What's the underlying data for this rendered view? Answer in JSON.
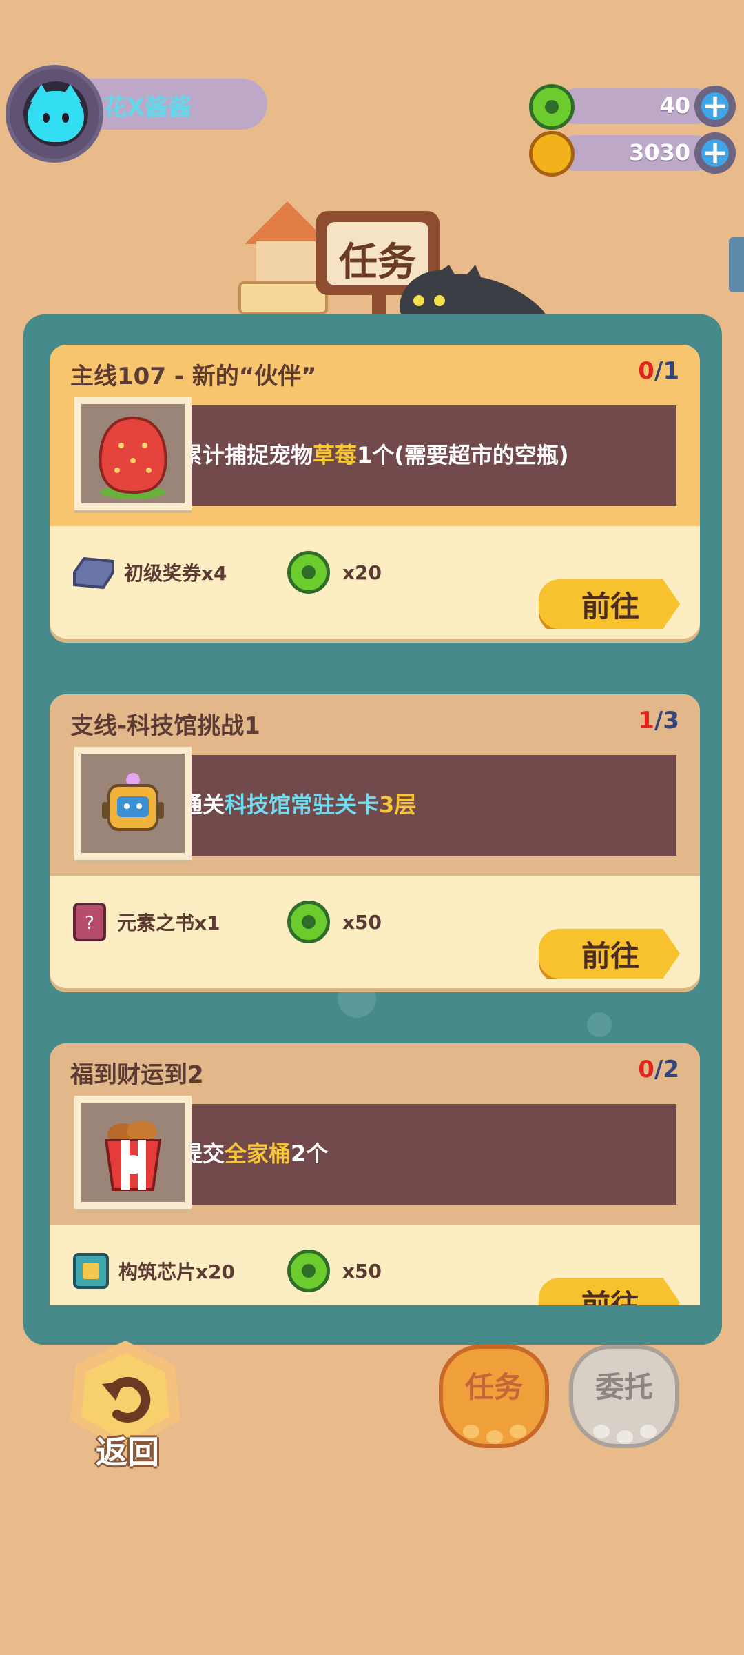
{
  "player": {
    "name": "花X酱酱"
  },
  "currencies": {
    "gems": {
      "value": "40",
      "icon": "green-donut-icon"
    },
    "coins": {
      "value": "3030",
      "icon": "gold-coin-icon"
    }
  },
  "header": {
    "title": "任务"
  },
  "tasks": [
    {
      "title": "主线107 - 新的“伙伴”",
      "progress_done": "0",
      "progress_sep": "/",
      "progress_total": "1",
      "desc_parts": [
        "累计捕捉宠物",
        "草莓",
        "1个(需要超市的空瓶)"
      ],
      "rewards": [
        {
          "label": "初级奖券x4",
          "icon": "ticket-icon"
        },
        {
          "label": "x20",
          "icon": "green-donut-icon"
        }
      ],
      "button": "前往",
      "thumb_icon": "strawberry-icon"
    },
    {
      "title": "支线-科技馆挑战1",
      "progress_done": "1",
      "progress_sep": "/",
      "progress_total": "3",
      "desc_parts": [
        "通关",
        "科技馆常驻关卡",
        "3层"
      ],
      "rewards": [
        {
          "label": "元素之书x1",
          "icon": "element-book-icon"
        },
        {
          "label": "x50",
          "icon": "green-donut-icon"
        }
      ],
      "button": "前往",
      "thumb_icon": "robot-icon"
    },
    {
      "title": "福到财运到2",
      "progress_done": "0",
      "progress_sep": "/",
      "progress_total": "2",
      "desc_parts": [
        "提交",
        "全家桶",
        "2个"
      ],
      "rewards": [
        {
          "label": "构筑芯片x20",
          "icon": "chip-icon"
        },
        {
          "label": "x50",
          "icon": "green-donut-icon"
        }
      ],
      "button": "前往",
      "thumb_icon": "chicken-bucket-icon"
    }
  ],
  "bottom": {
    "back_label": "返回",
    "tab_task": "任务",
    "tab_entrust": "委托"
  }
}
